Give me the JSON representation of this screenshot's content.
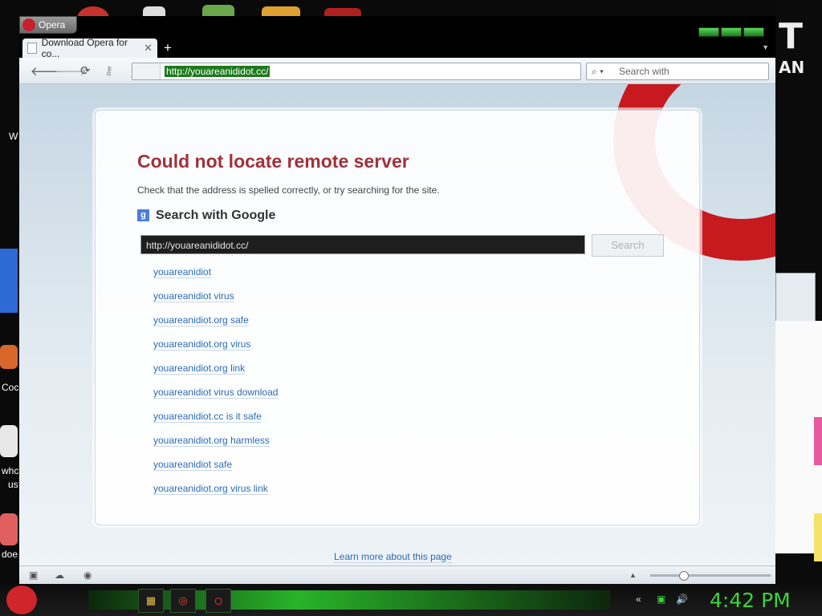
{
  "browser": {
    "menu_label": "Opera",
    "tab_title": "Download Opera for co...",
    "tab_close": "✕",
    "new_tab": "+",
    "address": "http://youareanididot.cc/",
    "search_placeholder": "Search with"
  },
  "error_page": {
    "title": "Could not locate remote server",
    "subtitle": "Check that the address is spelled correctly, or try searching for the site.",
    "search_heading": "Search with Google",
    "search_query": "http://youareanididot.cc/",
    "search_button": "Search",
    "suggestions": [
      "youareanidiot",
      "youareanidiot virus",
      "youareanidiot.org safe",
      "youareanidiot.org virus",
      "youareanidiot.org link",
      "youareanidiot virus download",
      "youareanidiot.cc is it safe",
      "youareanidiot.org harmless",
      "youareanidiot safe",
      "youareanidiot.org virus link"
    ],
    "learn_more": "Learn more about this page"
  },
  "taskbar": {
    "clock": "4:42 PM"
  },
  "desktop_fragments": {
    "left_1": "W",
    "left_2": "Coc",
    "left_3": "whc",
    "left_4": "us",
    "left_5": "doe",
    "right_1": "T",
    "right_2": "AN"
  },
  "colors": {
    "accent_green": "#39d439",
    "error_red": "#a0323a",
    "link_blue": "#2b6bb5",
    "opera_red": "#c71a1f"
  }
}
